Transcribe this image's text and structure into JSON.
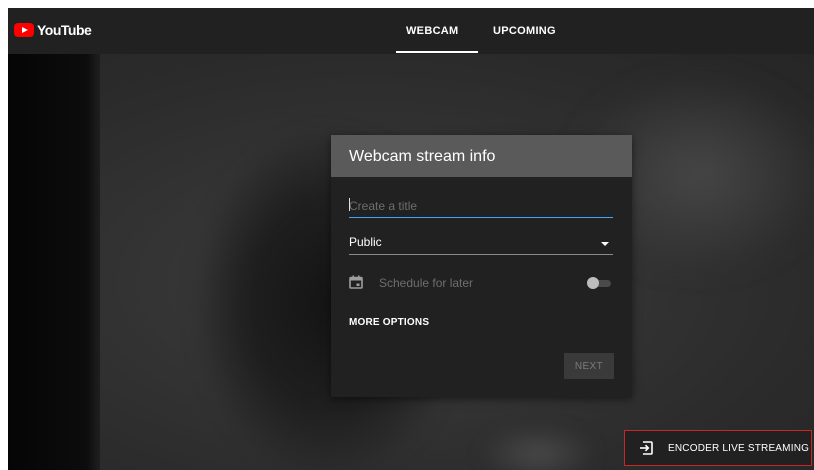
{
  "app": {
    "logo_text": "YouTube",
    "brand_color": "#ff0000"
  },
  "tabs": [
    {
      "label": "WEBCAM",
      "active": true
    },
    {
      "label": "UPCOMING",
      "active": false
    }
  ],
  "dialog": {
    "title": "Webcam stream info",
    "title_input": {
      "placeholder": "Create a title",
      "value": ""
    },
    "privacy": {
      "selected": "Public"
    },
    "schedule": {
      "label": "Schedule for later",
      "enabled": false,
      "icon": "calendar-icon"
    },
    "more_options_label": "MORE OPTIONS",
    "next_label": "NEXT"
  },
  "encoder_button": {
    "label": "ENCODER LIVE STREAMING",
    "icon": "input-arrow-icon",
    "highlight_color": "#c62828"
  },
  "colors": {
    "accent": "#3ea6ff",
    "topbar": "#212121",
    "dialog_header": "#5a5a5a"
  }
}
